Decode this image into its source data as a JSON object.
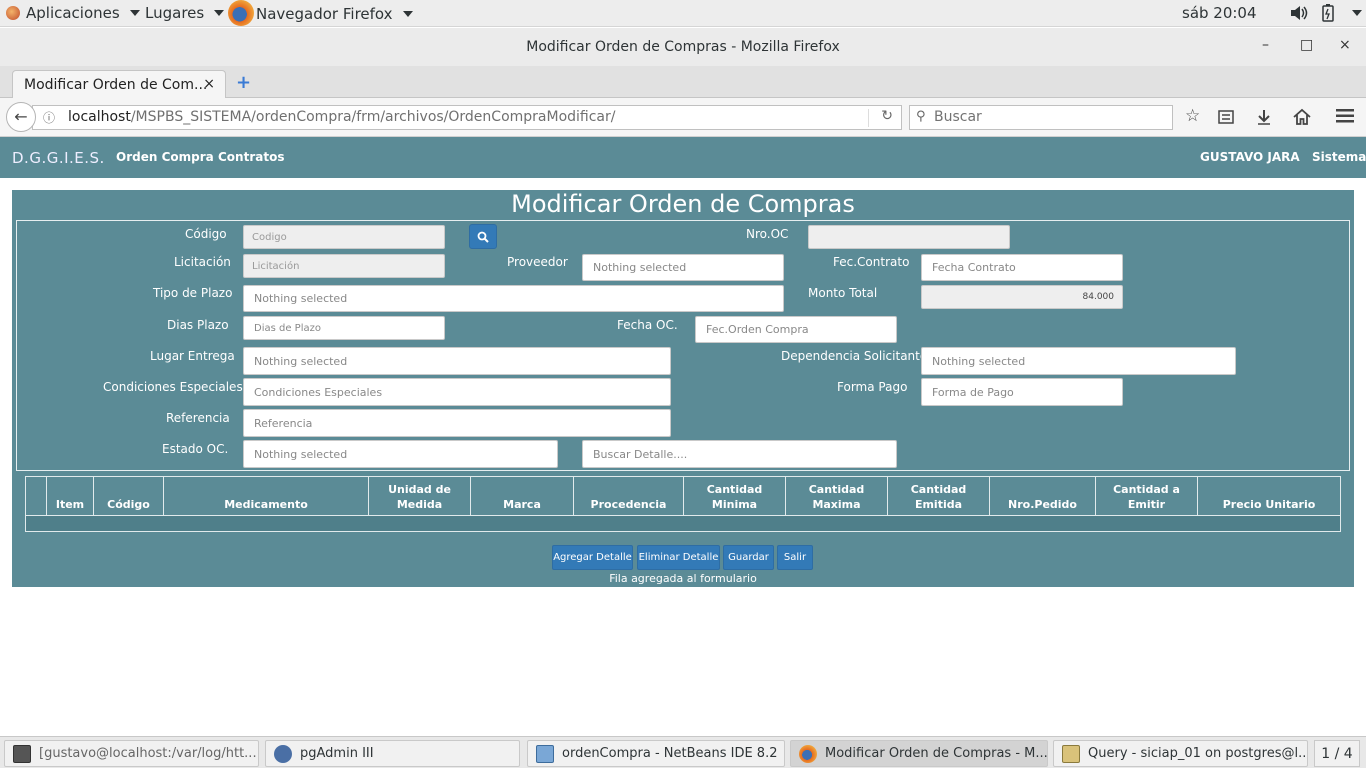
{
  "gnome_bar": {
    "applications": "Aplicaciones",
    "places": "Lugares",
    "active_app": "Navegador Firefox",
    "clock": "sáb 20:04"
  },
  "window": {
    "title": "Modificar Orden de Compras - Mozilla Firefox",
    "minimize": "–",
    "maximize": "□",
    "close": "×"
  },
  "tabs": [
    {
      "label": "Modificar Orden de Com...",
      "close": "×"
    }
  ],
  "new_tab": "+",
  "navigation": {
    "url_host": "localhost",
    "url_path": "/MSPBS_SISTEMA/ordenCompra/frm/archivos/OrdenCompraModificar/",
    "search_placeholder": "Buscar"
  },
  "app_nav": {
    "brand": "D.G.G.I.E.S.",
    "menu": [
      "Orden Compra",
      "Contratos"
    ],
    "user": "GUSTAVO JARA",
    "system": "Sistema"
  },
  "form": {
    "title": "Modificar Orden de Compras",
    "labels": {
      "codigo": "Código",
      "nro_oc": "Nro.OC",
      "licitacion": "Licitación",
      "proveedor": "Proveedor",
      "fec_contrato": "Fec.Contrato",
      "tipo_plazo": "Tipo de Plazo",
      "monto_total": "Monto Total",
      "dias_plazo": "Dias Plazo",
      "fecha_oc": "Fecha OC.",
      "lugar_entrega": "Lugar Entrega",
      "dependencia": "Dependencia Solicitante",
      "condiciones": "Condiciones Especiales",
      "forma_pago": "Forma Pago",
      "referencia": "Referencia",
      "estado_oc": "Estado OC."
    },
    "placeholders": {
      "codigo": "Codigo",
      "nro_oc": "",
      "licitacion": "Licitación",
      "proveedor": "Nothing selected",
      "fec_contrato": "Fecha Contrato",
      "tipo_plazo": "Nothing selected",
      "dias_plazo": "Dias de Plazo",
      "fecha_oc": "Fec.Orden Compra",
      "lugar_entrega": "Nothing selected",
      "dependencia": "Nothing selected",
      "condiciones": "Condiciones Especiales",
      "forma_pago": "Forma de Pago",
      "referencia": "Referencia",
      "estado_oc": "Nothing selected",
      "buscar_detalle": "Buscar Detalle...."
    },
    "values": {
      "monto_total": "84.000"
    }
  },
  "table": {
    "columns": [
      "",
      "Item",
      "Código",
      "Medicamento",
      "Unidad de Medida",
      "Marca",
      "Procedencia",
      "Cantidad Minima",
      "Cantidad Maxima",
      "Cantidad Emitida",
      "Nro.Pedido",
      "Cantidad a Emitir",
      "Precio Unitario"
    ]
  },
  "buttons": {
    "agregar": "Agregar Detalle",
    "eliminar": "Eliminar Detalle",
    "guardar": "Guardar",
    "salir": "Salir"
  },
  "status_message": "Fila agregada al formulario",
  "taskbar": {
    "items": [
      "[gustavo@localhost:/var/log/htt...",
      "pgAdmin III",
      "ordenCompra - NetBeans IDE 8.2",
      "Modificar Orden de Compras - M...",
      "Query - siciap_01 on postgres@l..."
    ],
    "pager": "1 / 4"
  }
}
